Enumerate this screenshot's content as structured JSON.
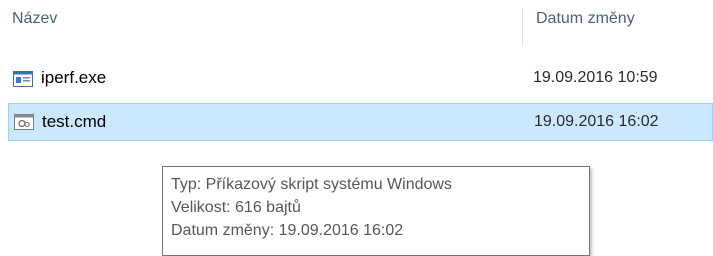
{
  "columns": {
    "name_label": "Název",
    "date_label": "Datum změny"
  },
  "files": [
    {
      "name": "iperf.exe",
      "date": "19.09.2016 10:59",
      "icon": "exe-file-icon"
    },
    {
      "name": "test.cmd",
      "date": "19.09.2016 16:02",
      "icon": "cmd-script-icon",
      "selected": true
    }
  ],
  "tooltip": {
    "type_line": "Typ: Příkazový skript systému Windows",
    "size_line": "Velikost: 616 bajtů",
    "date_line": "Datum změny: 19.09.2016 16:02"
  },
  "colors": {
    "selection_bg": "#cce8ff",
    "selection_border": "#99d1ff",
    "header_text": "#4c607a"
  }
}
